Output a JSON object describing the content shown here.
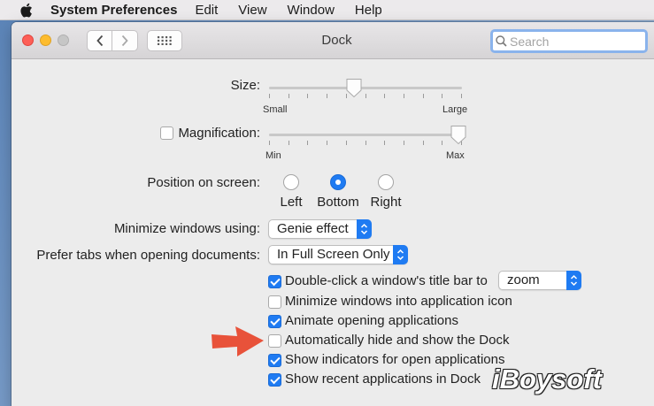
{
  "menubar": {
    "apple_icon": "apple-logo-icon",
    "app_name": "System Preferences",
    "menus": [
      "Edit",
      "View",
      "Window",
      "Help"
    ]
  },
  "window": {
    "title": "Dock",
    "search": {
      "value": "",
      "placeholder": "Search"
    }
  },
  "size": {
    "label": "Size:",
    "min_label": "Small",
    "max_label": "Large",
    "value": 0.44
  },
  "magnification": {
    "label": "Magnification:",
    "checked": false,
    "min_label": "Min",
    "max_label": "Max",
    "value": 1.0
  },
  "position": {
    "label": "Position on screen:",
    "options": [
      "Left",
      "Bottom",
      "Right"
    ],
    "selected": "Bottom"
  },
  "minimize": {
    "label": "Minimize windows using:",
    "value": "Genie effect"
  },
  "prefer_tabs": {
    "label": "Prefer tabs when opening documents:",
    "value": "In Full Screen Only"
  },
  "double_click": {
    "label": "Double-click a window's title bar to",
    "checked": true,
    "value": "zoom"
  },
  "checkboxes": [
    {
      "label": "Minimize windows into application icon",
      "checked": false
    },
    {
      "label": "Animate opening applications",
      "checked": true
    },
    {
      "label": "Automatically hide and show the Dock",
      "checked": false
    },
    {
      "label": "Show indicators for open applications",
      "checked": true
    },
    {
      "label": "Show recent applications in Dock",
      "checked": true
    }
  ],
  "annotation": {
    "arrow_color": "#e8523a"
  },
  "watermark": "iBoysoft"
}
